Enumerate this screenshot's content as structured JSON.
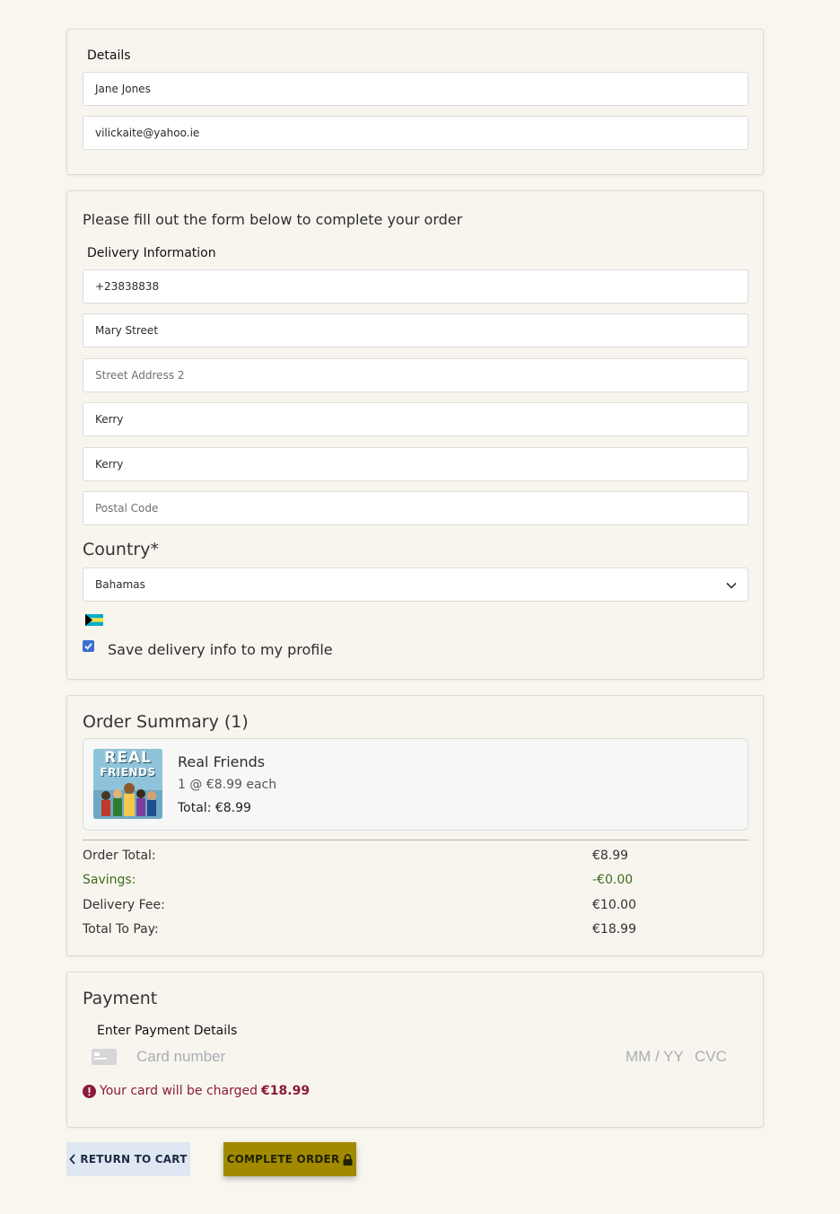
{
  "details": {
    "label": "Details",
    "full_name": "Jane Jones",
    "email": "vilickaite@yahoo.ie"
  },
  "delivery": {
    "intro": "Please fill out the form below to complete your order",
    "label": "Delivery Information",
    "phone": "+23838838",
    "street1": "Mary Street",
    "street2_placeholder": "Street Address 2",
    "town": "Kerry",
    "county": "Kerry",
    "postcode_placeholder": "Postal Code",
    "country_label": "Country*",
    "country_value": "Bahamas",
    "save_label": "Save delivery info to my profile",
    "save_checked": true
  },
  "order_summary": {
    "title": "Order Summary (1)",
    "item": {
      "name": "Real Friends",
      "qty_price": "1 @ €8.99 each",
      "total": "Total: €8.99",
      "cover_text_1": "REAL",
      "cover_text_2": "FRIENDS"
    },
    "rows": {
      "order_total_label": "Order Total:",
      "order_total_value": "€8.99",
      "savings_label": "Savings:",
      "savings_value": "-€0.00",
      "delivery_label": "Delivery Fee:",
      "delivery_value": "€10.00",
      "to_pay_label": "Total To Pay:",
      "to_pay_value": "€18.99"
    }
  },
  "payment": {
    "title": "Payment",
    "label": "Enter Payment Details",
    "card_placeholder": "Card number",
    "expiry_placeholder": "MM / YY",
    "cvc_placeholder": "CVC",
    "charge_prefix": "Your card will be charged",
    "charge_amount": "€18.99"
  },
  "buttons": {
    "return_label": "RETURN TO CART",
    "complete_label": "COMPLETE ORDER"
  },
  "colors": {
    "page_bg": "#f8f6ef",
    "complete_button": "#a28a00",
    "return_button": "#dfe7f3",
    "savings_green": "#3e6b1f",
    "warning_red": "#8b1a3a"
  }
}
